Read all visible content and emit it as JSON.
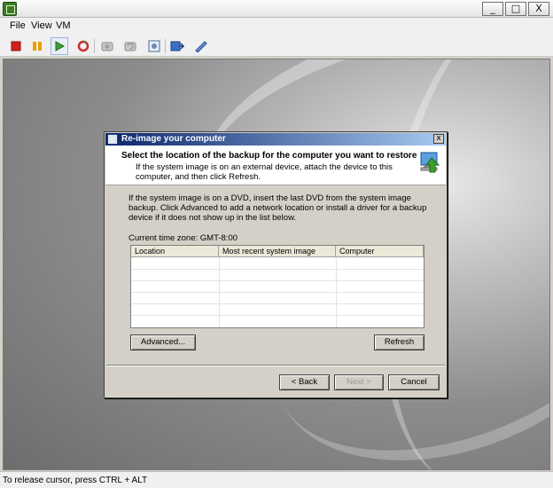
{
  "window": {
    "minimize_glyph": "_",
    "maximize_glyph": "□",
    "close_glyph": "X"
  },
  "menu": [
    "File",
    "View",
    "VM"
  ],
  "toolbar_icons": [
    "stop-icon",
    "pause-icon",
    "play-icon",
    "reset-icon",
    "snapshot-icon",
    "revert-snapshot-icon",
    "manage-snapshots-icon",
    "insert-disk-icon",
    "settings-icon"
  ],
  "colors": {
    "stop": "#d32020",
    "pause": "#e8a000",
    "play": "#3ca030",
    "reset": "#cc2a2a",
    "title_gradient_start": "#0a246a"
  },
  "dialog": {
    "title": "Re-image your computer",
    "close_glyph": "x",
    "header_title": "Select the location of the backup for the computer you want to restore",
    "header_subtitle": "If the system image is on an external device, attach the device to this computer, and then click Refresh.",
    "description": "If the system image is on a DVD, insert the last DVD from the system image backup. Click Advanced to add a network location or install a driver for a backup device if it does not show up in the list below.",
    "timezone": "Current time zone: GMT-8:00",
    "columns": [
      "Location",
      "Most recent system image",
      "Computer"
    ],
    "rows": [],
    "buttons": {
      "advanced": "Advanced...",
      "refresh": "Refresh",
      "back": "< Back",
      "next": "Next >",
      "cancel": "Cancel"
    }
  },
  "status": "To release cursor, press CTRL + ALT"
}
